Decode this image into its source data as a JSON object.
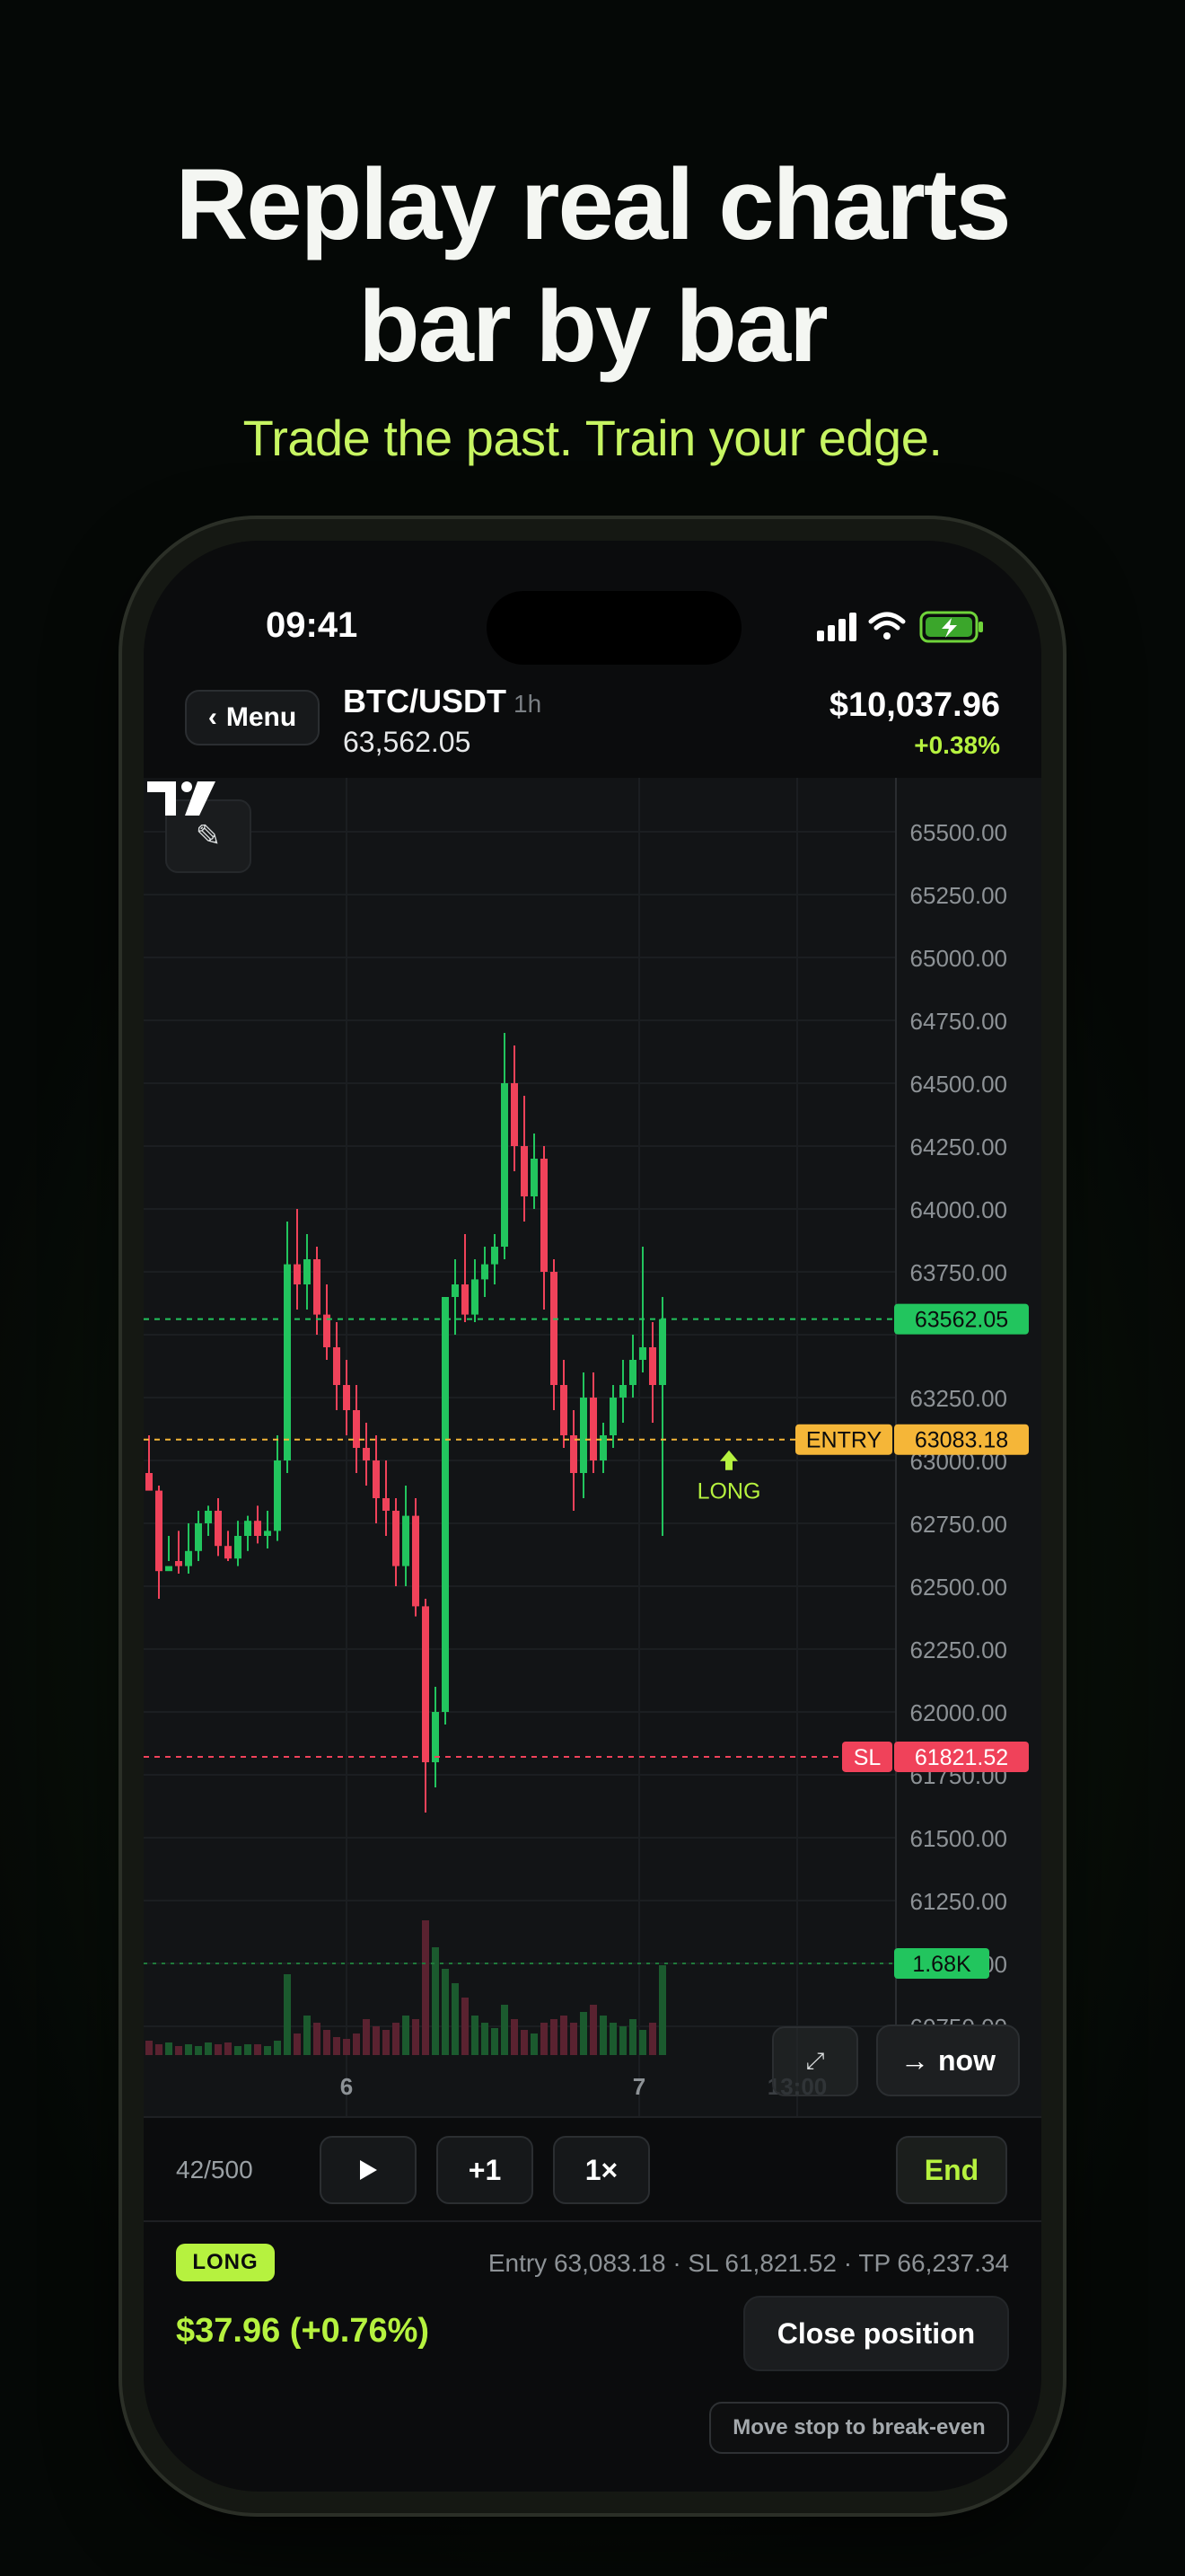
{
  "headline": {
    "line1": "Replay real charts",
    "line2": "bar by bar"
  },
  "subheadline": "Trade the past. Train your edge.",
  "status_bar": {
    "time": "09:41"
  },
  "header": {
    "menu_label": "Menu",
    "pair": "BTC/USDT",
    "timeframe": "1h",
    "pair_price": "63,562.05",
    "balance": "$10,037.96",
    "balance_change": "+0.38%"
  },
  "chart": {
    "price_axis": [
      "65500.00",
      "65250.00",
      "65000.00",
      "64750.00",
      "64500.00",
      "64250.00",
      "64000.00",
      "63750.00",
      "63250.00",
      "63000.00",
      "62750.00",
      "62500.00",
      "62250.00",
      "62000.00",
      "61750.00",
      "61500.00",
      "61250.00",
      "61000.00",
      "60750.00"
    ],
    "time_axis": [
      "6",
      "7",
      "13:00"
    ],
    "current_price_label": "63562.05",
    "entry_label": "ENTRY",
    "entry_price_label": "63083.18",
    "sl_label": "SL",
    "sl_price_label": "61821.52",
    "volume_label": "1.68K",
    "trade_marker": "LONG",
    "now_button": "now",
    "colors": {
      "up": "#22c55e",
      "down": "#f0425a",
      "entry": "#f5b638",
      "sl": "#f0425a",
      "current": "#22c55e",
      "accent": "#b6f23f"
    }
  },
  "chart_data": {
    "type": "candlestick",
    "price_range": [
      60750,
      65600
    ],
    "candles": [
      [
        62950,
        63100,
        62900,
        62880
      ],
      [
        62880,
        62900,
        62450,
        62560
      ],
      [
        62560,
        62700,
        62600,
        62580
      ],
      [
        62600,
        62720,
        62550,
        62580
      ],
      [
        62580,
        62750,
        62550,
        62640
      ],
      [
        62640,
        62800,
        62600,
        62750
      ],
      [
        62750,
        62820,
        62700,
        62800
      ],
      [
        62800,
        62850,
        62620,
        62660
      ],
      [
        62660,
        62720,
        62600,
        62610
      ],
      [
        62610,
        62760,
        62580,
        62700
      ],
      [
        62700,
        62780,
        62640,
        62760
      ],
      [
        62760,
        62820,
        62670,
        62700
      ],
      [
        62700,
        62800,
        62650,
        62720
      ],
      [
        62720,
        63100,
        62680,
        63000
      ],
      [
        63000,
        63950,
        62950,
        63780
      ],
      [
        63780,
        64000,
        63600,
        63700
      ],
      [
        63700,
        63900,
        63600,
        63800
      ],
      [
        63800,
        63850,
        63500,
        63580
      ],
      [
        63580,
        63700,
        63400,
        63450
      ],
      [
        63450,
        63550,
        63200,
        63300
      ],
      [
        63300,
        63400,
        63100,
        63200
      ],
      [
        63200,
        63300,
        62950,
        63050
      ],
      [
        63050,
        63150,
        62900,
        63000
      ],
      [
        63000,
        63100,
        62750,
        62850
      ],
      [
        62850,
        63000,
        62700,
        62800
      ],
      [
        62800,
        62850,
        62500,
        62580
      ],
      [
        62580,
        62900,
        62500,
        62780
      ],
      [
        62780,
        62850,
        62380,
        62420
      ],
      [
        62420,
        62450,
        61600,
        61800
      ],
      [
        61800,
        62100,
        61700,
        62000
      ],
      [
        62000,
        63650,
        61950,
        63650
      ],
      [
        63650,
        63800,
        63500,
        63700
      ],
      [
        63700,
        63900,
        63550,
        63580
      ],
      [
        63580,
        63800,
        63550,
        63720
      ],
      [
        63720,
        63850,
        63650,
        63780
      ],
      [
        63780,
        63900,
        63700,
        63850
      ],
      [
        63850,
        64700,
        63800,
        64500
      ],
      [
        64500,
        64650,
        64150,
        64250
      ],
      [
        64250,
        64450,
        63950,
        64050
      ],
      [
        64050,
        64300,
        64000,
        64200
      ],
      [
        64200,
        64250,
        63600,
        63750
      ],
      [
        63750,
        63800,
        63200,
        63300
      ],
      [
        63300,
        63400,
        63050,
        63100
      ],
      [
        63100,
        63200,
        62800,
        62950
      ],
      [
        62950,
        63350,
        62850,
        63250
      ],
      [
        63250,
        63350,
        62950,
        63000
      ],
      [
        63000,
        63150,
        62950,
        63100
      ],
      [
        63100,
        63300,
        63050,
        63250
      ],
      [
        63250,
        63400,
        63150,
        63300
      ],
      [
        63300,
        63500,
        63250,
        63400
      ],
      [
        63400,
        63850,
        63350,
        63450
      ],
      [
        63450,
        63550,
        63150,
        63300
      ],
      [
        63300,
        63650,
        62700,
        63562
      ]
    ],
    "volume": [
      8,
      6,
      7,
      5,
      6,
      5,
      7,
      6,
      7,
      5,
      6,
      6,
      5,
      8,
      45,
      12,
      22,
      18,
      14,
      10,
      9,
      12,
      20,
      16,
      14,
      18,
      22,
      20,
      75,
      60,
      48,
      40,
      32,
      22,
      18,
      15,
      28,
      20,
      14,
      12,
      18,
      20,
      22,
      18,
      24,
      28,
      22,
      18,
      16,
      20,
      14,
      18,
      50
    ],
    "entry_price": 63083.18,
    "stop_loss": 61821.52,
    "current_price": 63562.05
  },
  "controls": {
    "counter": "42/500",
    "play_icon": "play-icon",
    "step_label": "+1",
    "speed_label": "1×",
    "end_label": "End"
  },
  "position": {
    "side": "LONG",
    "entry": "Entry 63,083.18",
    "sl": "SL 61,821.52",
    "tp": "TP 66,237.34",
    "pnl": "$37.96 (+0.76%)",
    "close_label": "Close position",
    "breakeven_label": "Move stop to break-even"
  }
}
